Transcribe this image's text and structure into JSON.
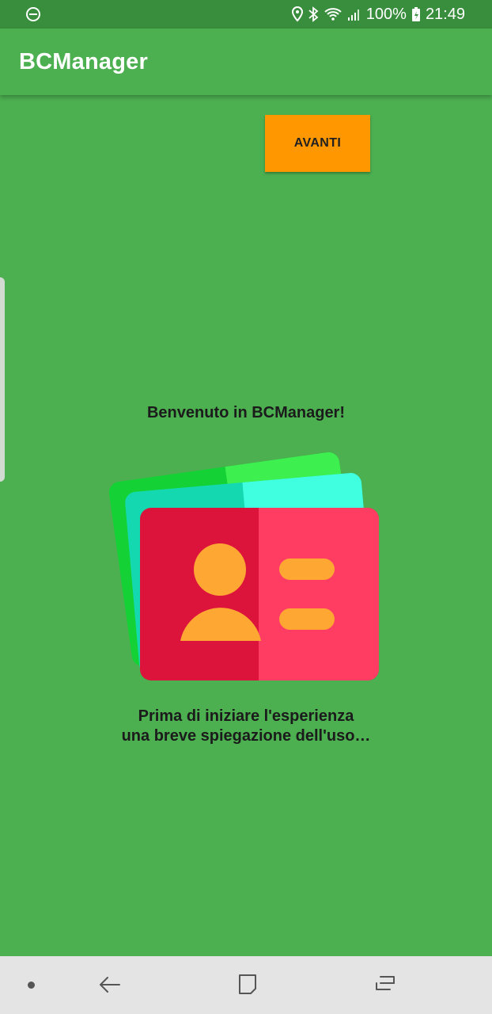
{
  "status_bar": {
    "battery": "100%",
    "time": "21:49",
    "icons": [
      "do-not-disturb-icon",
      "location-icon",
      "bluetooth-icon",
      "wifi-icon",
      "signal-icon",
      "battery-charging-icon"
    ]
  },
  "app_bar": {
    "title": "BCManager"
  },
  "actions": {
    "next_label": "AVANTI"
  },
  "content": {
    "welcome": "Benvenuto in BCManager!",
    "intro_line1": "Prima di iniziare l'esperienza",
    "intro_line2": "una breve spiegazione dell'uso…",
    "illustration": "business-card-stack-icon"
  },
  "nav_bar": {
    "icons": [
      "recent-dot-icon",
      "back-icon",
      "home-icon",
      "recents-icon"
    ]
  },
  "colors": {
    "primary": "#4caf50",
    "primary_dark": "#388e3c",
    "accent": "#ff9800",
    "card_red": "#dc143c",
    "card_pink": "#ff3d63",
    "avatar": "#ffa733"
  }
}
